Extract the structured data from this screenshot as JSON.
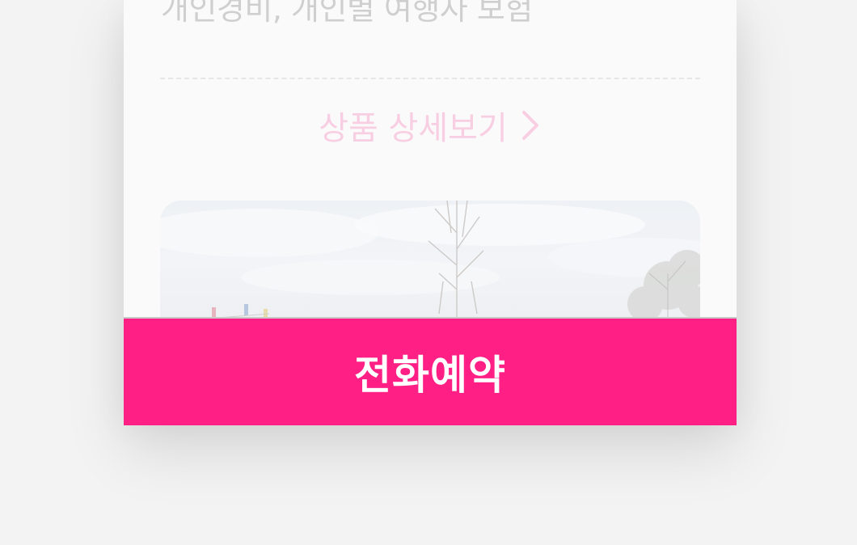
{
  "product": {
    "included_items_text": "개인경비, 개인별 여행자 보험",
    "detail_link_label": "상품 상세보기"
  },
  "booking": {
    "phone_reserve_label": "전화예약"
  },
  "colors": {
    "accent": "#ff1f85",
    "link": "#f8cfe2",
    "muted_text": "#cfcfcf"
  },
  "icons": {
    "detail_chevron": "chevron-right-icon"
  }
}
